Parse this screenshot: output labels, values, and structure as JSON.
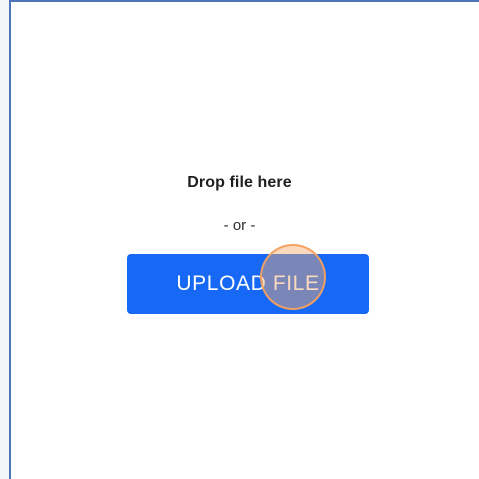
{
  "drop_zone": {
    "title": "Drop file here",
    "divider": "- or -",
    "upload_button_label": "UPLOAD FILE"
  },
  "colors": {
    "button_background": "#1769f5",
    "frame_accent": "#4f72b8",
    "cursor_highlight": "#f4a060"
  }
}
